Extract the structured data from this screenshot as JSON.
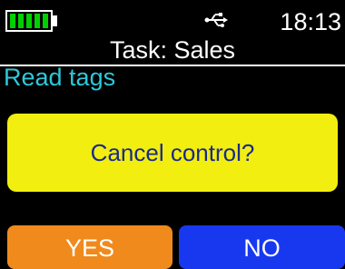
{
  "status_bar": {
    "time": "18:13",
    "battery_level": 1.0,
    "icon": "usb-icon"
  },
  "header": {
    "title": "Task: Sales"
  },
  "section": {
    "label": "Read tags"
  },
  "dialog": {
    "message": "Cancel control?"
  },
  "buttons": {
    "yes_label": "YES",
    "no_label": "NO"
  },
  "colors": {
    "background": "#000000",
    "text": "#ffffff",
    "section_label": "#2ec8d8",
    "battery": "#00d000",
    "dialog_bg": "#f2ee10",
    "dialog_text": "#1a2a8a",
    "yes_button": "#f08a1c",
    "no_button": "#1838f0"
  }
}
